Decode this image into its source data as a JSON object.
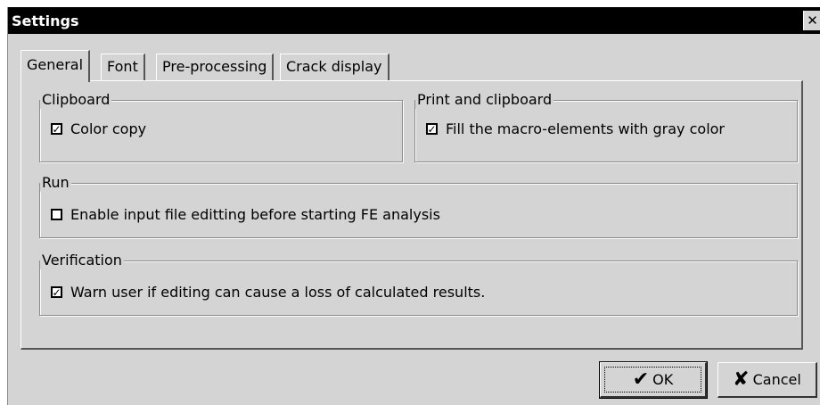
{
  "window": {
    "title": "Settings",
    "close_glyph": "✕"
  },
  "tabs": [
    {
      "label": "General",
      "active": true
    },
    {
      "label": "Font",
      "active": false
    },
    {
      "label": "Pre-processing",
      "active": false
    },
    {
      "label": "Crack display",
      "active": false
    }
  ],
  "groups": {
    "clipboard": {
      "title": "Clipboard",
      "option": {
        "label": "Color copy",
        "checked": true
      }
    },
    "print_clipboard": {
      "title": "Print and clipboard",
      "option": {
        "label": "Fill the macro-elements with gray color",
        "checked": true
      }
    },
    "run": {
      "title": "Run",
      "option": {
        "label": "Enable input file editting before starting FE analysis",
        "checked": false
      }
    },
    "verification": {
      "title": "Verification",
      "option": {
        "label": "Warn user if editing can cause a loss of calculated results.",
        "checked": true
      }
    }
  },
  "buttons": {
    "ok": {
      "label": "OK",
      "icon": "checkmark-icon",
      "glyph": "✔"
    },
    "cancel": {
      "label": "Cancel",
      "icon": "x-icon",
      "glyph": "✘"
    }
  },
  "check_glyph": "✓"
}
